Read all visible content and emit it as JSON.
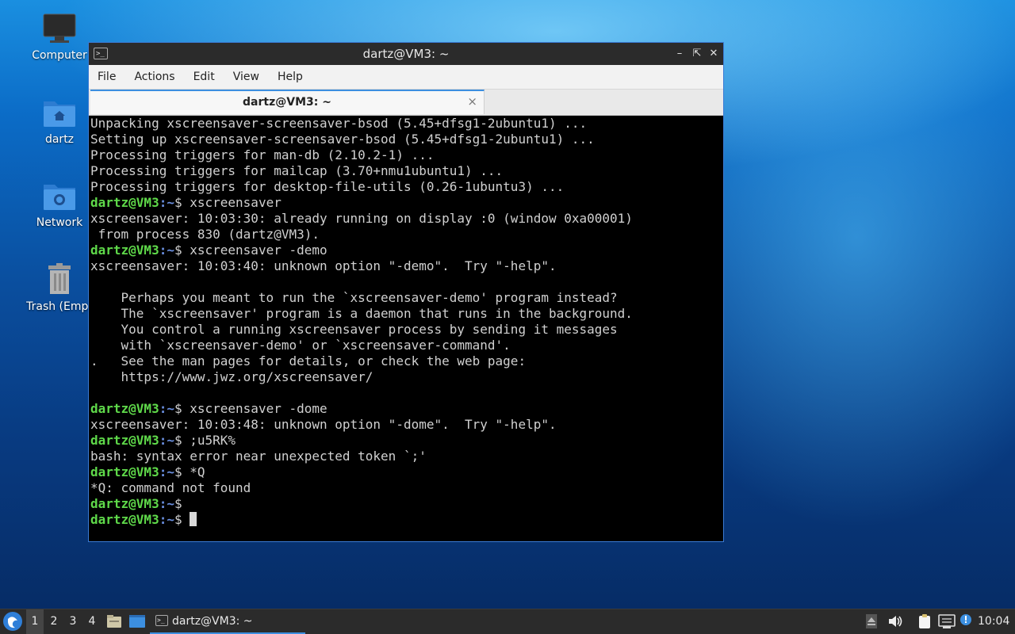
{
  "desktop": {
    "icons": [
      {
        "label": "Computer"
      },
      {
        "label": "dartz"
      },
      {
        "label": "Network"
      },
      {
        "label": "Trash (Empt"
      }
    ]
  },
  "window": {
    "title": "dartz@VM3: ~",
    "menu": [
      "File",
      "Actions",
      "Edit",
      "View",
      "Help"
    ],
    "tab_label": "dartz@VM3: ~",
    "tab_close": "×",
    "prompt_user": "dartz@VM3",
    "prompt_path": ":~",
    "prompt_sign": "$",
    "lines": [
      {
        "text": "Unpacking xscreensaver-screensaver-bsod (5.45+dfsg1-2ubuntu1) ..."
      },
      {
        "text": "Setting up xscreensaver-screensaver-bsod (5.45+dfsg1-2ubuntu1) ..."
      },
      {
        "text": "Processing triggers for man-db (2.10.2-1) ..."
      },
      {
        "text": "Processing triggers for mailcap (3.70+nmu1ubuntu1) ..."
      },
      {
        "text": "Processing triggers for desktop-file-utils (0.26-1ubuntu3) ..."
      },
      {
        "prompt": true,
        "cmd": " xscreensaver"
      },
      {
        "text": "xscreensaver: 10:03:30: already running on display :0 (window 0xa00001)"
      },
      {
        "text": " from process 830 (dartz@VM3)."
      },
      {
        "prompt": true,
        "cmd": " xscreensaver -demo"
      },
      {
        "text": "xscreensaver: 10:03:40: unknown option \"-demo\".  Try \"-help\"."
      },
      {
        "text": ""
      },
      {
        "text": "    Perhaps you meant to run the `xscreensaver-demo' program instead?"
      },
      {
        "text": "    The `xscreensaver' program is a daemon that runs in the background."
      },
      {
        "text": "    You control a running xscreensaver process by sending it messages"
      },
      {
        "text": "    with `xscreensaver-demo' or `xscreensaver-command'."
      },
      {
        "text": ".   See the man pages for details, or check the web page:"
      },
      {
        "text": "    https://www.jwz.org/xscreensaver/"
      },
      {
        "text": ""
      },
      {
        "prompt": true,
        "cmd": " xscreensaver -dome"
      },
      {
        "text": "xscreensaver: 10:03:48: unknown option \"-dome\".  Try \"-help\"."
      },
      {
        "prompt": true,
        "cmd": " ;u5RK%"
      },
      {
        "text": "bash: syntax error near unexpected token `;'"
      },
      {
        "prompt": true,
        "cmd": " *Q"
      },
      {
        "text": "*Q: command not found"
      },
      {
        "prompt": true,
        "cmd": ""
      },
      {
        "prompt": true,
        "cmd": " ",
        "cursor": true
      }
    ]
  },
  "taskbar": {
    "workspaces": [
      "1",
      "2",
      "3",
      "4"
    ],
    "active_workspace": "1",
    "task_label": "dartz@VM3: ~",
    "clock": "10:04"
  },
  "colors": {
    "prompt_user": "#5fd94a",
    "prompt_path": "#6a8fe0",
    "accent": "#3c8fe0"
  }
}
